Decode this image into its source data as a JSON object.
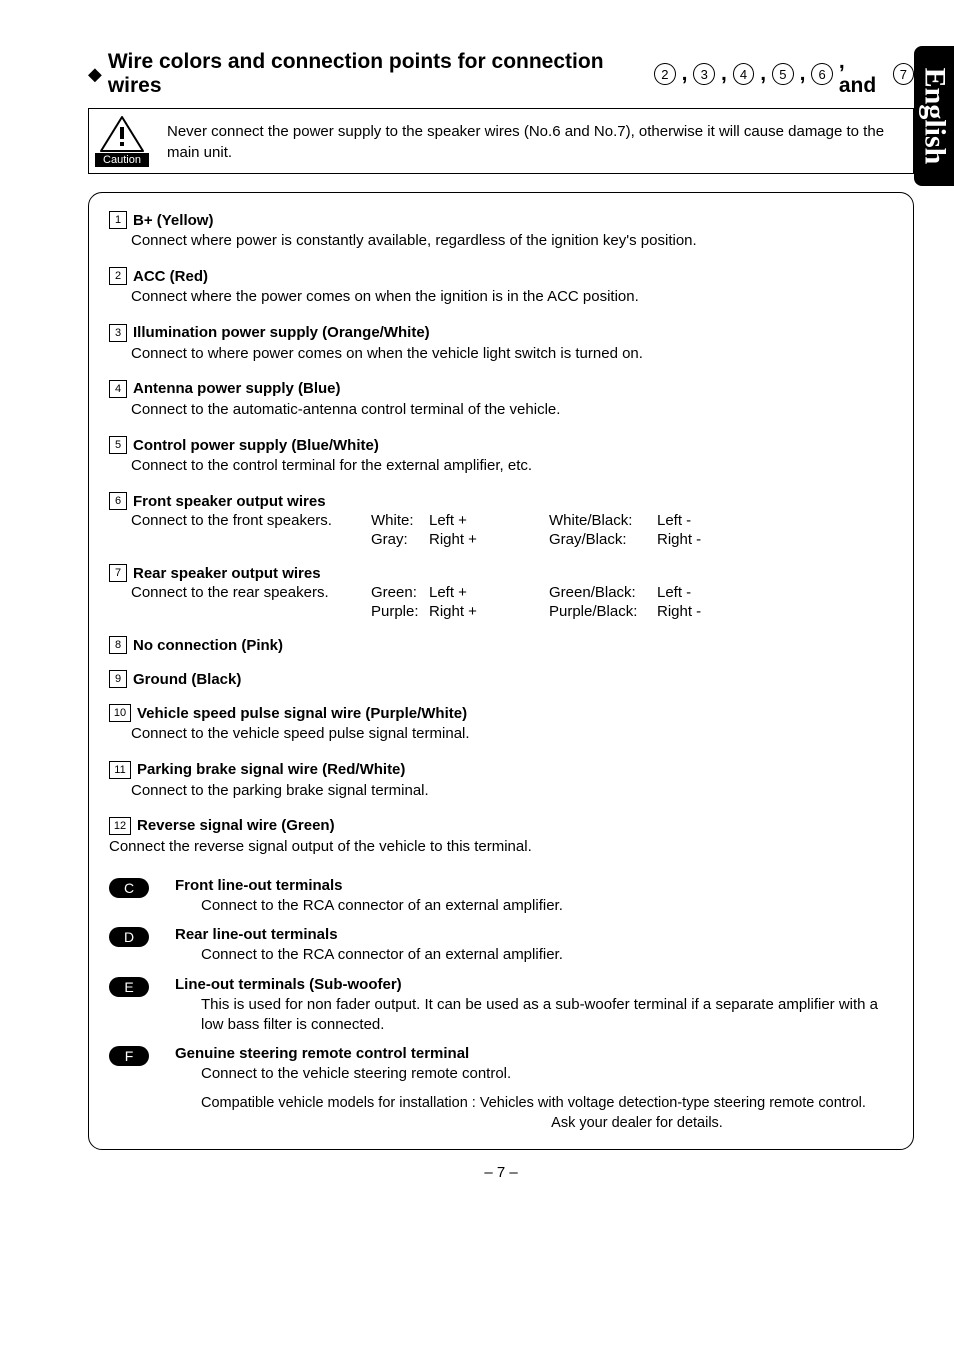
{
  "language_tab": "English",
  "heading": {
    "prefix": "Wire colors and connection points for connection wires",
    "nums": [
      "2",
      "3",
      "4",
      "5",
      "6"
    ],
    "and": ", and",
    "last": "7"
  },
  "caution": {
    "label": "Caution",
    "text": "Never connect the power supply to the speaker wires (No.6 and No.7), otherwise it will cause damage to the main unit."
  },
  "items": [
    {
      "n": "1",
      "title": "B+ (Yellow)",
      "desc": "Connect where power is constantly available, regardless of the ignition key's position."
    },
    {
      "n": "2",
      "title": "ACC (Red)",
      "desc": "Connect where the power comes on when the ignition is in the ACC position."
    },
    {
      "n": "3",
      "title": "Illumination power supply (Orange/White)",
      "desc": "Connect to where power comes on when the vehicle light switch is turned on."
    },
    {
      "n": "4",
      "title": "Antenna power supply (Blue)",
      "desc": "Connect to the automatic-antenna control terminal of the vehicle."
    },
    {
      "n": "5",
      "title": "Control power supply (Blue/White)",
      "desc": "Connect to the control terminal for the external amplifier, etc."
    }
  ],
  "front_speakers": {
    "n": "6",
    "title": "Front speaker output wires",
    "desc": "Connect to the front speakers.",
    "c1": [
      "White:",
      "Gray:"
    ],
    "c2": [
      "Left +",
      "Right +"
    ],
    "c3": [
      "White/Black:",
      "Gray/Black:"
    ],
    "c4": [
      "Left -",
      "Right -"
    ]
  },
  "rear_speakers": {
    "n": "7",
    "title": "Rear speaker output wires",
    "desc": "Connect to the rear speakers.",
    "c1": [
      "Green:",
      "Purple:"
    ],
    "c2": [
      "Left +",
      "Right +"
    ],
    "c3": [
      "Green/Black:",
      "Purple/Black:"
    ],
    "c4": [
      "Left -",
      "Right -"
    ]
  },
  "simple_items": [
    {
      "n": "8",
      "title": "No connection (Pink)"
    },
    {
      "n": "9",
      "title": "Ground (Black)"
    }
  ],
  "items2": [
    {
      "n": "10",
      "title": "Vehicle speed pulse signal wire (Purple/White)",
      "desc": "Connect to the vehicle speed pulse signal terminal."
    },
    {
      "n": "11",
      "title": "Parking brake signal wire (Red/White)",
      "desc": "Connect to the parking brake signal terminal."
    },
    {
      "n": "12",
      "title": "Reverse signal wire (Green)",
      "desc": "Connect the reverse signal output of the vehicle to this terminal."
    }
  ],
  "letter_items": [
    {
      "l": "C",
      "title": "Front line-out terminals",
      "desc": "Connect to the RCA connector of an external amplifier."
    },
    {
      "l": "D",
      "title": "Rear line-out terminals",
      "desc": "Connect to the RCA connector of an external amplifier."
    },
    {
      "l": "E",
      "title": "Line-out terminals (Sub-woofer)",
      "desc": "This is used for non fader output. It can be used as a sub-woofer terminal if a separate amplifier with a low bass filter is connected."
    },
    {
      "l": "F",
      "title": "Genuine steering remote control terminal",
      "desc": "Connect to the vehicle steering remote control."
    }
  ],
  "compat": {
    "line1": "Compatible vehicle models for installation : Vehicles with voltage detection-type steering remote control.",
    "line2": "Ask your dealer for details."
  },
  "page_number": "– 7 –"
}
